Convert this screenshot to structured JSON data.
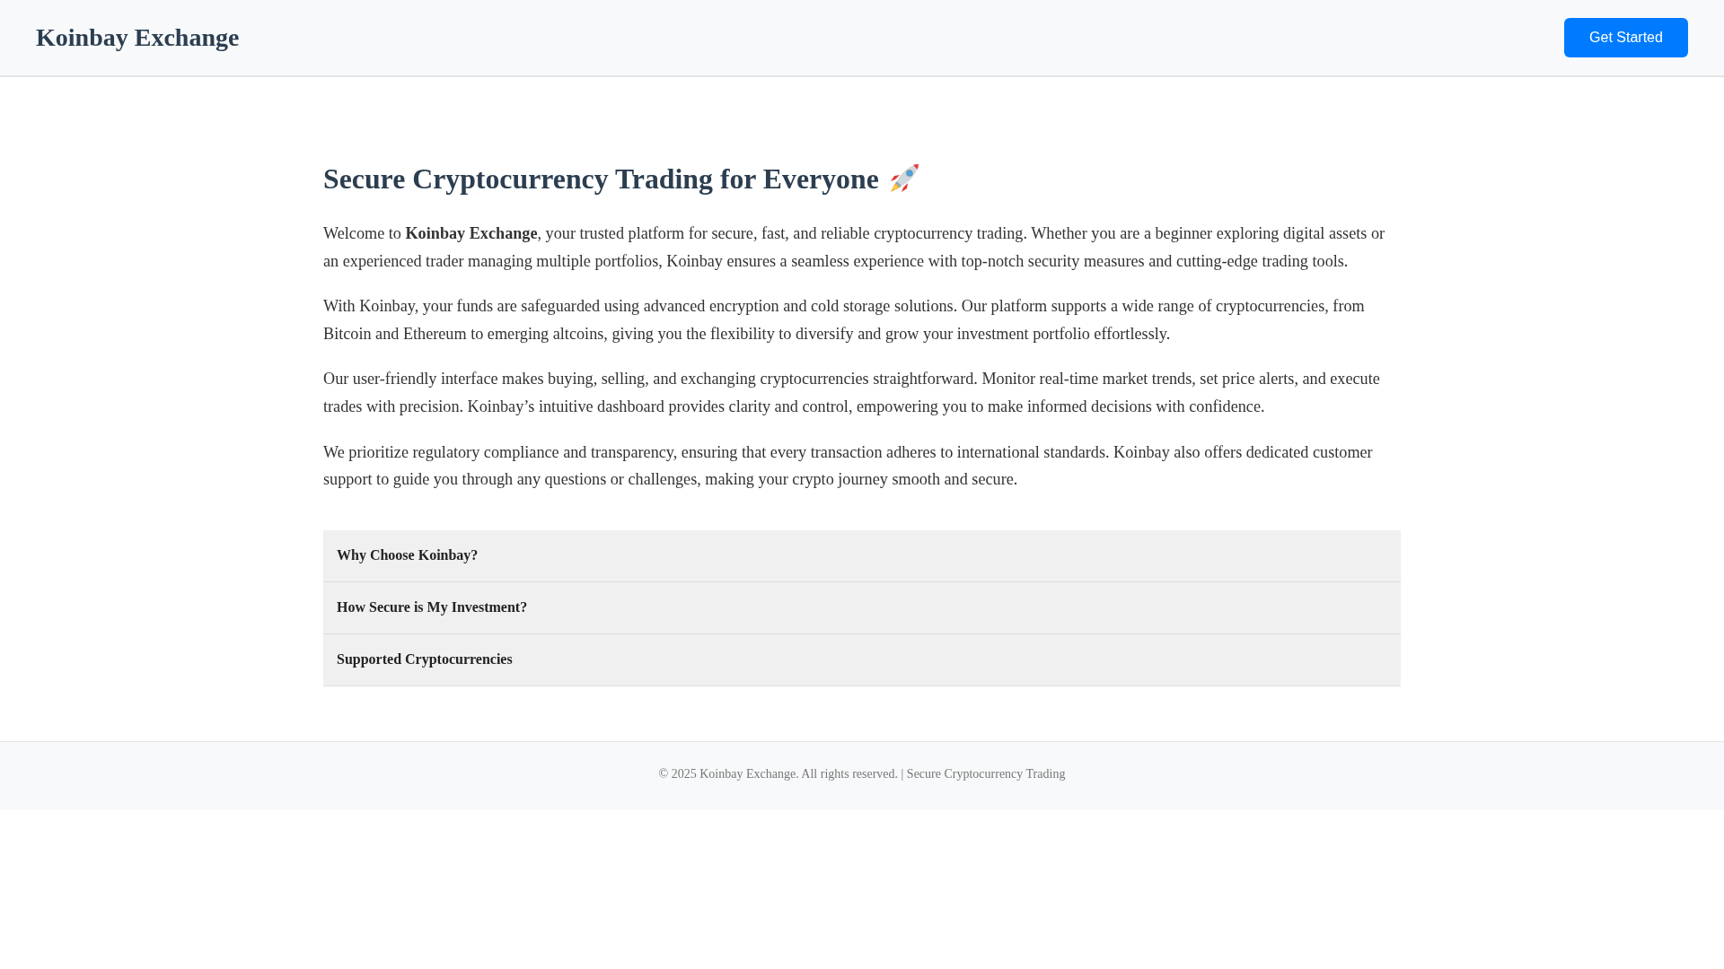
{
  "header": {
    "brand": "Koinbay Exchange",
    "button": "Get Started"
  },
  "main": {
    "heading": "Secure Cryptocurrency Trading for Everyone",
    "paragraphs": [
      "Welcome to **Koinbay Exchange**, your trusted platform for secure, fast, and reliable cryptocurrency trading. Whether you are a beginner exploring digital assets or an experienced trader managing multiple portfolios, Koinbay ensures a seamless experience with top-notch security measures and cutting-edge trading tools.",
      "With Koinbay, your funds are safeguarded using advanced encryption and cold storage solutions. Our platform supports a wide range of cryptocurrencies, from Bitcoin and Ethereum to emerging altcoins, giving you the flexibility to diversify and grow your investment portfolio effortlessly.",
      "Our user-friendly interface makes buying, selling, and exchanging cryptocurrencies straightforward. Monitor real-time market trends, set price alerts, and execute trades with precision. Koinbay’s intuitive dashboard provides clarity and control, empowering you to make informed decisions with confidence.",
      "We prioritize regulatory compliance and transparency, ensuring that every transaction adheres to international standards. Koinbay also offers dedicated customer support to guide you through any questions or challenges, making your crypto journey smooth and secure."
    ]
  },
  "accordion": [
    {
      "title": "Why Choose Koinbay?"
    },
    {
      "title": "How Secure is My Investment?"
    },
    {
      "title": "Supported Cryptocurrencies"
    }
  ],
  "footer": {
    "text": "© 2025 Koinbay Exchange. All rights reserved. | Secure Cryptocurrency Trading"
  }
}
